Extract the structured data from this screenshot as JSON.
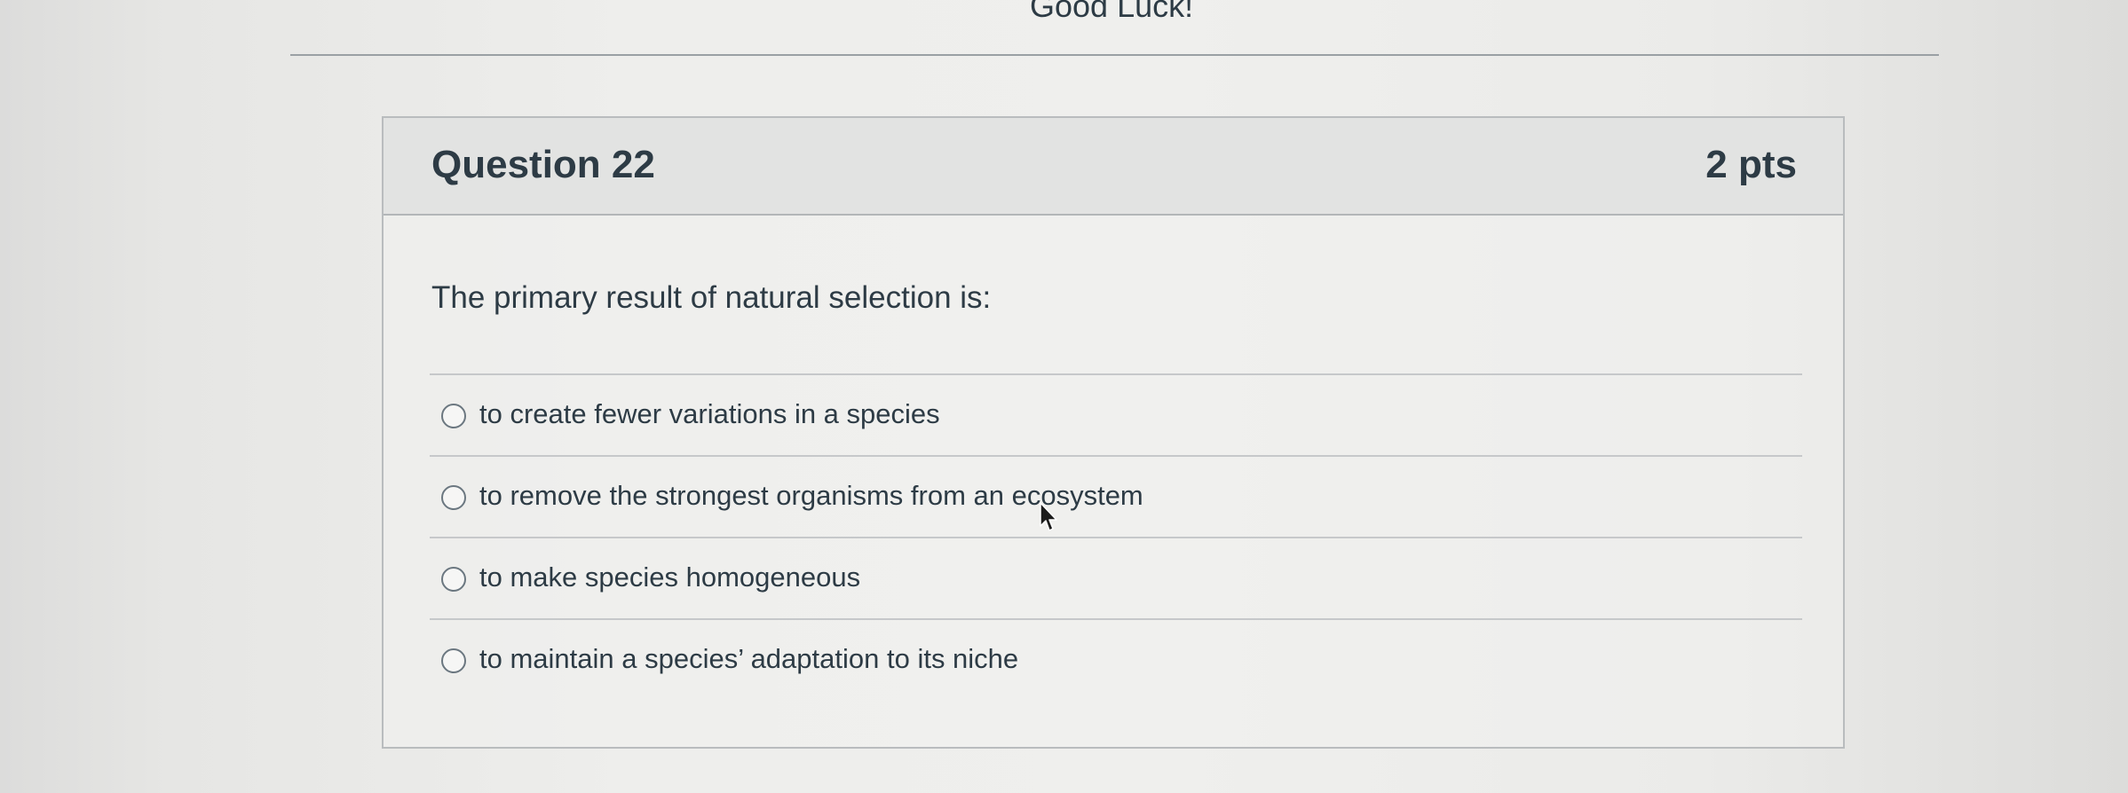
{
  "intro_text": "Good Luck!",
  "question": {
    "title": "Question 22",
    "points": "2 pts",
    "text": "The primary result of natural selection is:",
    "answers": [
      {
        "label": "to create fewer variations in a species",
        "selected": false
      },
      {
        "label": "to remove the strongest organisms from an ecosystem",
        "selected": false
      },
      {
        "label": "to make species homogeneous",
        "selected": false
      },
      {
        "label": "to maintain a species’ adaptation to its niche",
        "selected": false
      }
    ]
  },
  "icons": {
    "cursor": "mouse-pointer-icon",
    "radio": "radio-button"
  },
  "colors": {
    "text": "#2d3b45",
    "header_bg": "#e2e3e2",
    "border": "#b9bcbe"
  }
}
